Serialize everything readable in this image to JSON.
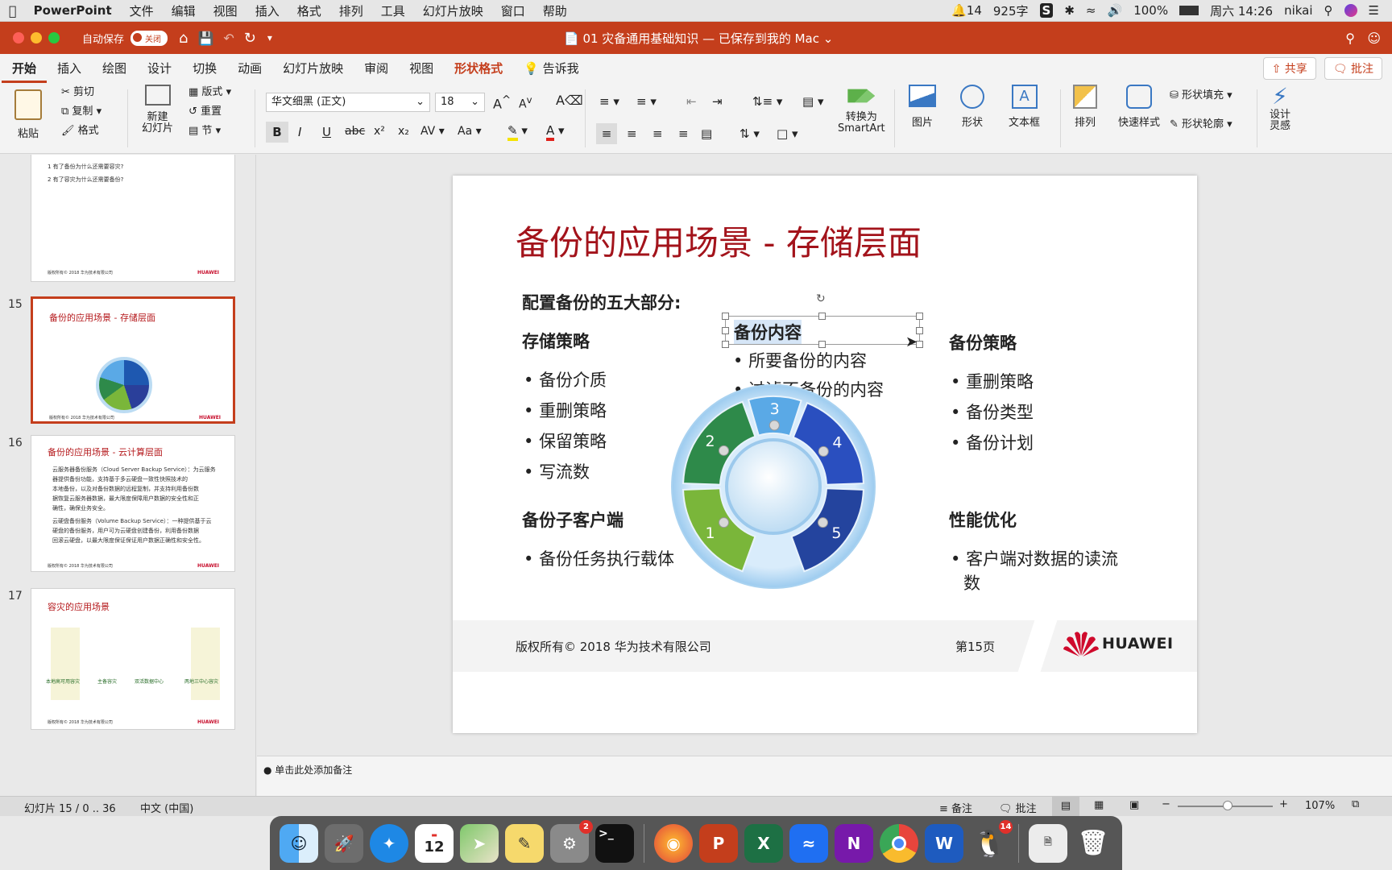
{
  "menubar": {
    "app": "PowerPoint",
    "items": [
      "文件",
      "编辑",
      "视图",
      "插入",
      "格式",
      "排列",
      "工具",
      "幻灯片放映",
      "窗口",
      "帮助"
    ],
    "notif_count": "14",
    "word_count": "925字",
    "battery": "100%",
    "clock": "周六 14:26",
    "user": "nikai"
  },
  "titlebar": {
    "autosave": "自动保存",
    "autosave_state": "关闭",
    "title": "01 灾备通用基础知识 — 已保存到我的 Mac"
  },
  "tabs": [
    "开始",
    "插入",
    "绘图",
    "设计",
    "切换",
    "动画",
    "幻灯片放映",
    "审阅",
    "视图",
    "形状格式"
  ],
  "tell_me": "告诉我",
  "share": "共享",
  "comments": "批注",
  "ribbon": {
    "paste": "粘贴",
    "cut": "剪切",
    "copy": "复制",
    "format": "格式",
    "new_slide": "新建\n幻灯片",
    "layout": "版式",
    "reset": "重置",
    "section": "节",
    "font": "华文细黑 (正文)",
    "font_size": "18",
    "bold": "B",
    "italic": "I",
    "underline": "U",
    "strike": "abc",
    "sup": "x²",
    "sub": "x₂",
    "spacing": "AV",
    "case": "Aa",
    "smartart": "转换为\nSmartArt",
    "picture": "图片",
    "shapes": "形状",
    "textbox": "文本框",
    "arrange": "排列",
    "quick_styles": "快速样式",
    "shape_fill": "形状填充",
    "shape_outline": "形状轮廓",
    "designer": "设计\n灵感"
  },
  "thumbs": [
    {
      "num": "",
      "lines": [
        "1 有了备份为什么还需要容灾?",
        "2 有了容灾为什么还需要备份?"
      ]
    },
    {
      "num": "15",
      "title": "备份的应用场景 - 存储层面"
    },
    {
      "num": "16",
      "title": "备份的应用场景 - 云计算层面",
      "lines": [
        "云服务器备份服务（Cloud Server Backup Service）：为云服务",
        "器提供备份功能，支持基于多云硬盘一致性快照技术的",
        "本地备份，以及对备份数据的远程复制，并支持利用备份数",
        "据恢复云服务器数据，最大限度保障用户数据的安全性和正",
        "确性，确保业务安全。",
        "云硬盘备份服务（Volume Backup Service）：一种提供基于云",
        "硬盘的备份服务，用户可为云硬盘创建备份，利用备份数据",
        "回滚云硬盘，以最大限度保证保证用户数据正确性和安全性。"
      ]
    },
    {
      "num": "17",
      "title": "容灾的应用场景",
      "labels": [
        "本地高可用容灾",
        "主备容灾",
        "双活数据中心",
        "两地三中心容灾"
      ]
    }
  ],
  "slide": {
    "title": "备份的应用场景 - 存储层面",
    "subtitle": "配置备份的五大部分:",
    "sections": [
      {
        "heading": "存储策略",
        "items": [
          "备份介质",
          "重删策略",
          "保留策略",
          "写流数"
        ]
      },
      {
        "heading": "备份子客户端",
        "items": [
          "备份任务执行载体"
        ]
      },
      {
        "heading": "备份内容",
        "items": [
          "所要备份的内容",
          "过滤不备份的内容"
        ]
      },
      {
        "heading": "备份策略",
        "items": [
          "重删策略",
          "备份类型",
          "备份计划"
        ]
      },
      {
        "heading": "性能优化",
        "items": [
          "客户端对数据的读流",
          "数"
        ]
      }
    ],
    "ring_numbers": [
      "1",
      "2",
      "3",
      "4",
      "5"
    ],
    "footer": "版权所有© 2018 华为技术有限公司",
    "page": "第15页",
    "logo": "HUAWEI"
  },
  "thumb_footer": "版权所有© 2018 华为技术有限公司",
  "thumb_logo": "HUAWEI",
  "notes": "单击此处添加备注",
  "status": {
    "slide": "幻灯片 15 / 0 .. 36",
    "lang": "中文 (中国)",
    "notes": "备注",
    "comments": "批注",
    "zoom": "107%"
  },
  "dock_badges": {
    "calendar": "12",
    "settings": "2",
    "qq": "14"
  }
}
